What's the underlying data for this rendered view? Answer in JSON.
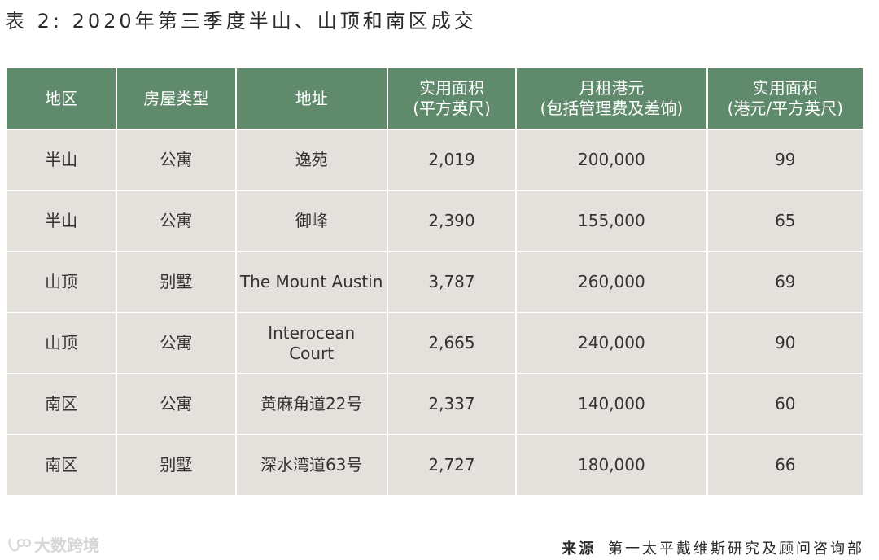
{
  "title": "表 2: 2020年第三季度半山、山顶和南区成交",
  "table": {
    "headers": [
      {
        "line1": "地区",
        "line2": ""
      },
      {
        "line1": "房屋类型",
        "line2": ""
      },
      {
        "line1": "地址",
        "line2": ""
      },
      {
        "line1": "实用面积",
        "line2": "(平方英尺)"
      },
      {
        "line1": "月租港元",
        "line2": "(包括管理费及差饷)"
      },
      {
        "line1": "实用面积",
        "line2": "(港元/平方英尺)"
      }
    ],
    "rows": [
      {
        "region": "半山",
        "type": "公寓",
        "address_line1": "逸苑",
        "address_line2": "",
        "area": "2,019",
        "rent": "200,000",
        "psf": "99"
      },
      {
        "region": "半山",
        "type": "公寓",
        "address_line1": "御峰",
        "address_line2": "",
        "area": "2,390",
        "rent": "155,000",
        "psf": "65"
      },
      {
        "region": "山顶",
        "type": "别墅",
        "address_line1": "The Mount Austin",
        "address_line2": "",
        "area": "3,787",
        "rent": "260,000",
        "psf": "69"
      },
      {
        "region": "山顶",
        "type": "公寓",
        "address_line1": "Interocean",
        "address_line2": "Court",
        "area": "2,665",
        "rent": "240,000",
        "psf": "90"
      },
      {
        "region": "南区",
        "type": "公寓",
        "address_line1": "黄麻角道22号",
        "address_line2": "",
        "area": "2,337",
        "rent": "140,000",
        "psf": "60"
      },
      {
        "region": "南区",
        "type": "别墅",
        "address_line1": "深水湾道63号",
        "address_line2": "",
        "area": "2,727",
        "rent": "180,000",
        "psf": "66"
      }
    ]
  },
  "watermark": {
    "text": "大数跨境",
    "icon": "brand-logo-icon"
  },
  "source": {
    "label": "来源",
    "text": "第一太平戴维斯研究及顾问咨询部"
  },
  "colors": {
    "header_bg": "#5f8a6c",
    "cell_bg": "#e4e0db",
    "header_text": "#ffffff",
    "body_text": "#333333"
  }
}
